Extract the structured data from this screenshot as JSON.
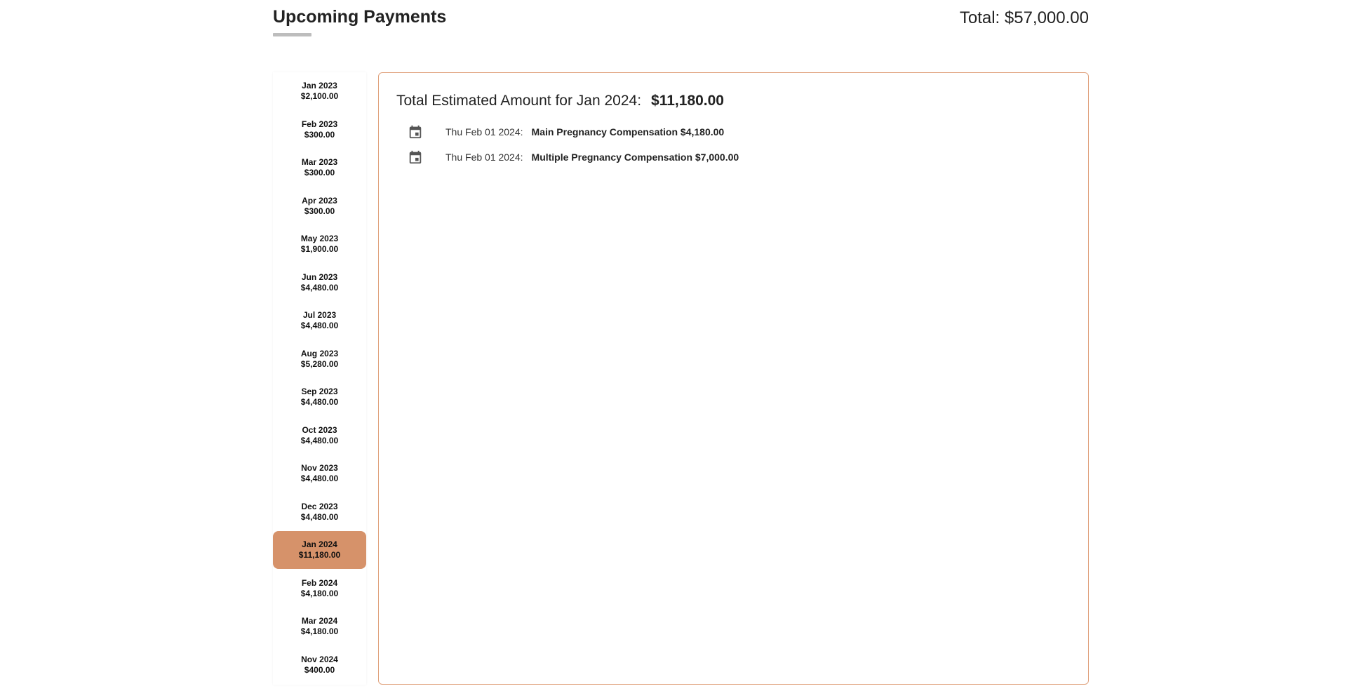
{
  "header": {
    "title": "Upcoming Payments",
    "total": "Total: $57,000.00"
  },
  "months": [
    {
      "month": "Jan 2023",
      "amount": "$2,100.00"
    },
    {
      "month": "Feb 2023",
      "amount": "$300.00"
    },
    {
      "month": "Mar 2023",
      "amount": "$300.00"
    },
    {
      "month": "Apr 2023",
      "amount": "$300.00"
    },
    {
      "month": "May 2023",
      "amount": "$1,900.00"
    },
    {
      "month": "Jun 2023",
      "amount": "$4,480.00"
    },
    {
      "month": "Jul 2023",
      "amount": "$4,480.00"
    },
    {
      "month": "Aug 2023",
      "amount": "$5,280.00"
    },
    {
      "month": "Sep 2023",
      "amount": "$4,480.00"
    },
    {
      "month": "Oct 2023",
      "amount": "$4,480.00"
    },
    {
      "month": "Nov 2023",
      "amount": "$4,480.00"
    },
    {
      "month": "Dec 2023",
      "amount": "$4,480.00"
    },
    {
      "month": "Jan 2024",
      "amount": "$11,180.00",
      "selected": true
    },
    {
      "month": "Feb 2024",
      "amount": "$4,180.00"
    },
    {
      "month": "Mar 2024",
      "amount": "$4,180.00"
    },
    {
      "month": "Nov 2024",
      "amount": "$400.00"
    }
  ],
  "detail": {
    "heading_label": "Total Estimated Amount for Jan 2024:",
    "heading_amount": "$11,180.00",
    "payments": [
      {
        "date": "Thu Feb 01 2024:",
        "description": "Main Pregnancy Compensation $4,180.00",
        "icon": "calendar-icon"
      },
      {
        "date": "Thu Feb 01 2024:",
        "description": "Multiple Pregnancy Compensation $7,000.00",
        "icon": "calendar-icon"
      }
    ]
  },
  "colors": {
    "accent": "#d6926a",
    "panel_border": "#e0a27d",
    "underline": "#bdbdbd"
  }
}
